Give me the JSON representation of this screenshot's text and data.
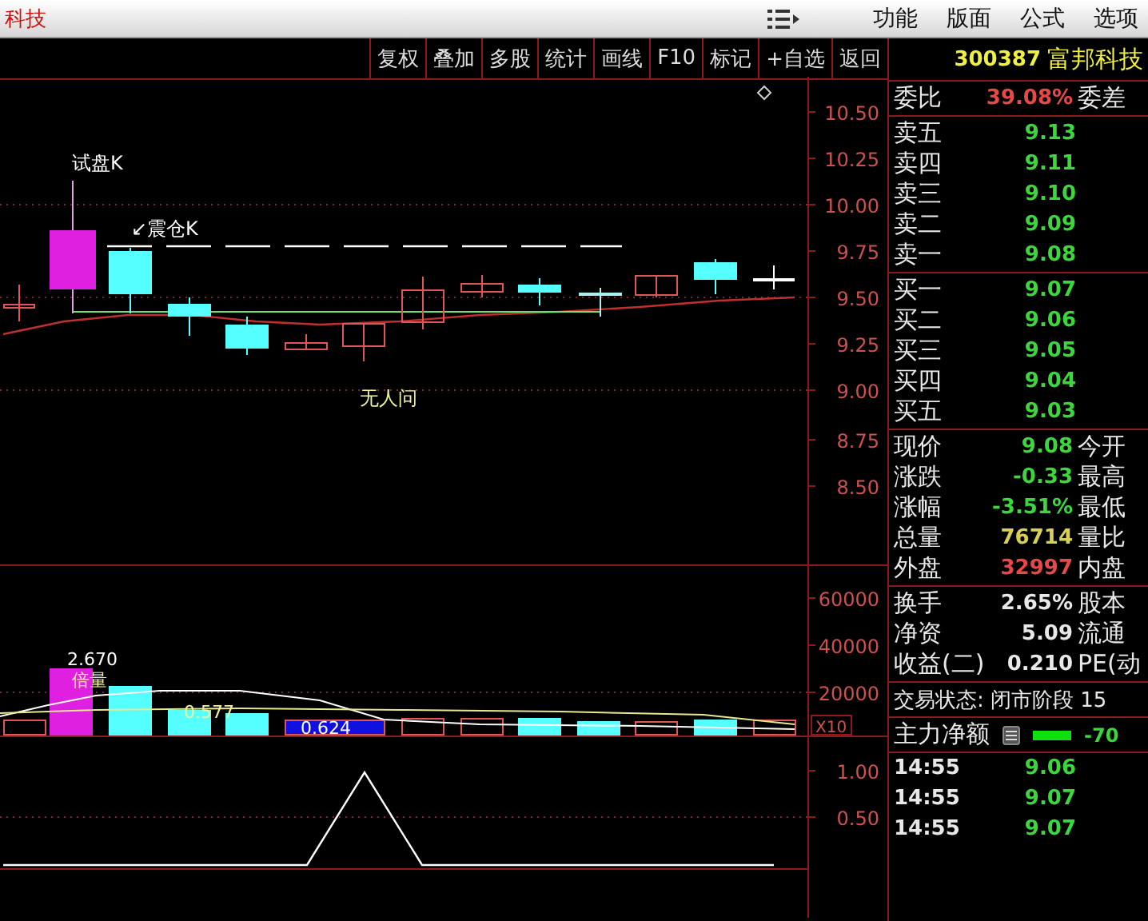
{
  "menubar": {
    "title": "科技",
    "menus": [
      "功能",
      "版面",
      "公式",
      "选项"
    ]
  },
  "toolbar": {
    "buttons": [
      "复权",
      "叠加",
      "多股",
      "统计",
      "画线",
      "F10",
      "标记",
      "+自选",
      "返回"
    ]
  },
  "price_chart": {
    "axis": [
      "10.50",
      "10.25",
      "10.00",
      "9.75",
      "9.50",
      "9.25",
      "9.00",
      "8.75",
      "8.50"
    ],
    "annotations": [
      "试盘K",
      "↙震仓K",
      "无人问"
    ]
  },
  "volume_chart": {
    "axis": [
      "60000",
      "40000",
      "20000"
    ],
    "labels": [
      "2.670",
      "倍量",
      "0.577",
      "0.624"
    ],
    "scale": "X10"
  },
  "indicator_chart": {
    "axis": [
      "1.00",
      "0.50"
    ]
  },
  "quote": {
    "code": "300387",
    "name": "富邦科技",
    "ratio": {
      "label": "委比",
      "value": "39.08%",
      "label2": "委差"
    },
    "asks": [
      {
        "label": "卖五",
        "price": "9.13"
      },
      {
        "label": "卖四",
        "price": "9.11"
      },
      {
        "label": "卖三",
        "price": "9.10"
      },
      {
        "label": "卖二",
        "price": "9.09"
      },
      {
        "label": "卖一",
        "price": "9.08"
      }
    ],
    "bids": [
      {
        "label": "买一",
        "price": "9.07"
      },
      {
        "label": "买二",
        "price": "9.06"
      },
      {
        "label": "买三",
        "price": "9.05"
      },
      {
        "label": "买四",
        "price": "9.04"
      },
      {
        "label": "买五",
        "price": "9.03"
      }
    ],
    "stats": [
      {
        "label": "现价",
        "value": "9.08",
        "label2": "今开",
        "color": "#3ad83a"
      },
      {
        "label": "涨跌",
        "value": "-0.33",
        "label2": "最高",
        "color": "#3ad83a"
      },
      {
        "label": "涨幅",
        "value": "-3.51%",
        "label2": "最低",
        "color": "#3ad83a"
      },
      {
        "label": "总量",
        "value": "76714",
        "label2": "量比",
        "color": "#d8d050"
      },
      {
        "label": "外盘",
        "value": "32997",
        "label2": "内盘",
        "color": "#e84848"
      }
    ],
    "info": [
      {
        "label": "换手",
        "value": "2.65%",
        "label2": "股本"
      },
      {
        "label": "净资",
        "value": "5.09",
        "label2": "流通"
      },
      {
        "label": "收益(二)",
        "value": "0.210",
        "label2": "PE(动"
      }
    ],
    "status": "交易状态: 闭市阶段 15",
    "main_flow": {
      "label": "主力净额",
      "value": "-70"
    },
    "ticks": [
      {
        "time": "14:55",
        "price": "9.06"
      },
      {
        "time": "14:55",
        "price": "9.07"
      },
      {
        "time": "14:55",
        "price": "9.07"
      }
    ]
  }
}
